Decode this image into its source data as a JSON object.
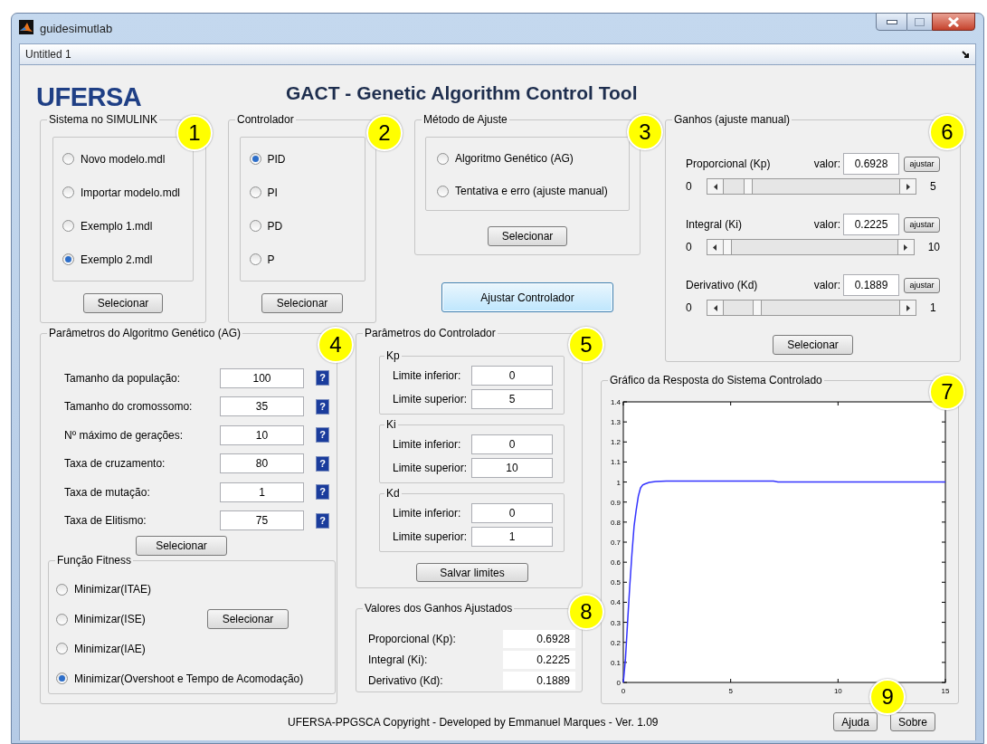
{
  "window": {
    "title": "guidesimutlab",
    "document": "Untitled 1"
  },
  "header": {
    "logo": "UFERSA",
    "title": "GACT - Genetic Algorithm Control Tool"
  },
  "simulink_panel": {
    "title": "Sistema no SIMULINK",
    "marker": "1",
    "options": [
      {
        "label": "Novo modelo.mdl",
        "selected": false
      },
      {
        "label": "Importar modelo.mdl",
        "selected": false
      },
      {
        "label": "Exemplo 1.mdl",
        "selected": false
      },
      {
        "label": "Exemplo 2.mdl",
        "selected": true
      }
    ],
    "button": "Selecionar"
  },
  "controller_panel": {
    "title": "Controlador",
    "marker": "2",
    "options": [
      {
        "label": "PID",
        "selected": true
      },
      {
        "label": "PI",
        "selected": false
      },
      {
        "label": "PD",
        "selected": false
      },
      {
        "label": "P",
        "selected": false
      }
    ],
    "button": "Selecionar"
  },
  "method_panel": {
    "title": "Método de Ajuste",
    "marker": "3",
    "options": [
      {
        "label": "Algoritmo Genético (AG)",
        "selected": false
      },
      {
        "label": "Tentativa e erro (ajuste manual)",
        "selected": false
      }
    ],
    "button": "Selecionar"
  },
  "tune_button": "Ajustar Controlador",
  "gains_panel": {
    "title": "Ganhos (ajuste manual)",
    "marker": "6",
    "gains": [
      {
        "label": "Proporcional (Kp)",
        "value_label": "valor:",
        "value": "0.6928",
        "button": "ajustar",
        "min": "0",
        "max": "5",
        "level": 0.139
      },
      {
        "label": "Integral (Ki)",
        "value_label": "valor:",
        "value": "0.2225",
        "button": "ajustar",
        "min": "0",
        "max": "10",
        "level": 0.022
      },
      {
        "label": "Derivativo (Kd)",
        "value_label": "valor:",
        "value": "0.1889",
        "button": "ajustar",
        "min": "0",
        "max": "1",
        "level": 0.189
      }
    ],
    "button": "Selecionar"
  },
  "ga_panel": {
    "title": "Parâmetros do Algoritmo Genético (AG)",
    "marker": "4",
    "params": [
      {
        "label": "Tamanho da população:",
        "value": "100",
        "help": "?"
      },
      {
        "label": "Tamanho do cromossomo:",
        "value": "35",
        "help": "?"
      },
      {
        "label": "Nº máximo de gerações:",
        "value": "10",
        "help": "?"
      },
      {
        "label": "Taxa de cruzamento:",
        "value": "80",
        "help": "?"
      },
      {
        "label": "Taxa de mutação:",
        "value": "1",
        "help": "?"
      },
      {
        "label": "Taxa de Elitismo:",
        "value": "75",
        "help": "?"
      }
    ],
    "button": "Selecionar",
    "fitness": {
      "title": "Função Fitness",
      "options": [
        {
          "label": "Minimizar(ITAE)",
          "selected": false
        },
        {
          "label": "Minimizar(ISE)",
          "selected": false
        },
        {
          "label": "Minimizar(IAE)",
          "selected": false
        },
        {
          "label": "Minimizar(Overshoot e Tempo de Acomodação)",
          "selected": true
        }
      ],
      "button": "Selecionar"
    }
  },
  "limits_panel": {
    "title": "Parâmetros do Controlador",
    "marker": "5",
    "groups": [
      {
        "title": "Kp",
        "rows": [
          {
            "label": "Limite inferior:",
            "value": "0"
          },
          {
            "label": "Limite superior:",
            "value": "5"
          }
        ]
      },
      {
        "title": "Ki",
        "rows": [
          {
            "label": "Limite inferior:",
            "value": "0"
          },
          {
            "label": "Limite superior:",
            "value": "10"
          }
        ]
      },
      {
        "title": "Kd",
        "rows": [
          {
            "label": "Limite inferior:",
            "value": "0"
          },
          {
            "label": "Limite superior:",
            "value": "1"
          }
        ]
      }
    ],
    "button": "Salvar limites"
  },
  "results_panel": {
    "title": "Valores dos Ganhos Ajustados",
    "marker": "8",
    "rows": [
      {
        "label": "Proporcional (Kp):",
        "value": "0.6928"
      },
      {
        "label": "Integral (Ki):",
        "value": "0.2225"
      },
      {
        "label": "Derivativo (Kd):",
        "value": "0.1889"
      }
    ]
  },
  "chart_panel": {
    "title": "Gráfico da Resposta do Sistema Controlado",
    "marker": "7",
    "chart_data": {
      "type": "line",
      "x": [
        0,
        0.1,
        0.2,
        0.3,
        0.4,
        0.5,
        0.6,
        0.7,
        0.8,
        0.9,
        1,
        1.2,
        1.5,
        2,
        7,
        7.2,
        15
      ],
      "series": [
        {
          "color": "#3333ff",
          "values": [
            0,
            0.12,
            0.3,
            0.48,
            0.64,
            0.78,
            0.86,
            0.93,
            0.97,
            0.985,
            0.99,
            0.998,
            1.003,
            1.005,
            1.005,
            1.0,
            1.0
          ]
        }
      ],
      "xlim": [
        0,
        15
      ],
      "ylim": [
        0,
        1.4
      ],
      "xticks": [
        0,
        5,
        10,
        15
      ],
      "yticks": [
        0,
        0.1,
        0.2,
        0.3,
        0.4,
        0.5,
        0.6,
        0.7,
        0.8,
        0.9,
        1,
        1.1,
        1.2,
        1.3,
        1.4
      ]
    }
  },
  "footer": {
    "copyright": "UFERSA-PPGSCA Copyright - Developed by Emmanuel Marques - Ver. 1.09",
    "marker": "9",
    "buttons": [
      "Ajuda",
      "Sobre"
    ]
  }
}
